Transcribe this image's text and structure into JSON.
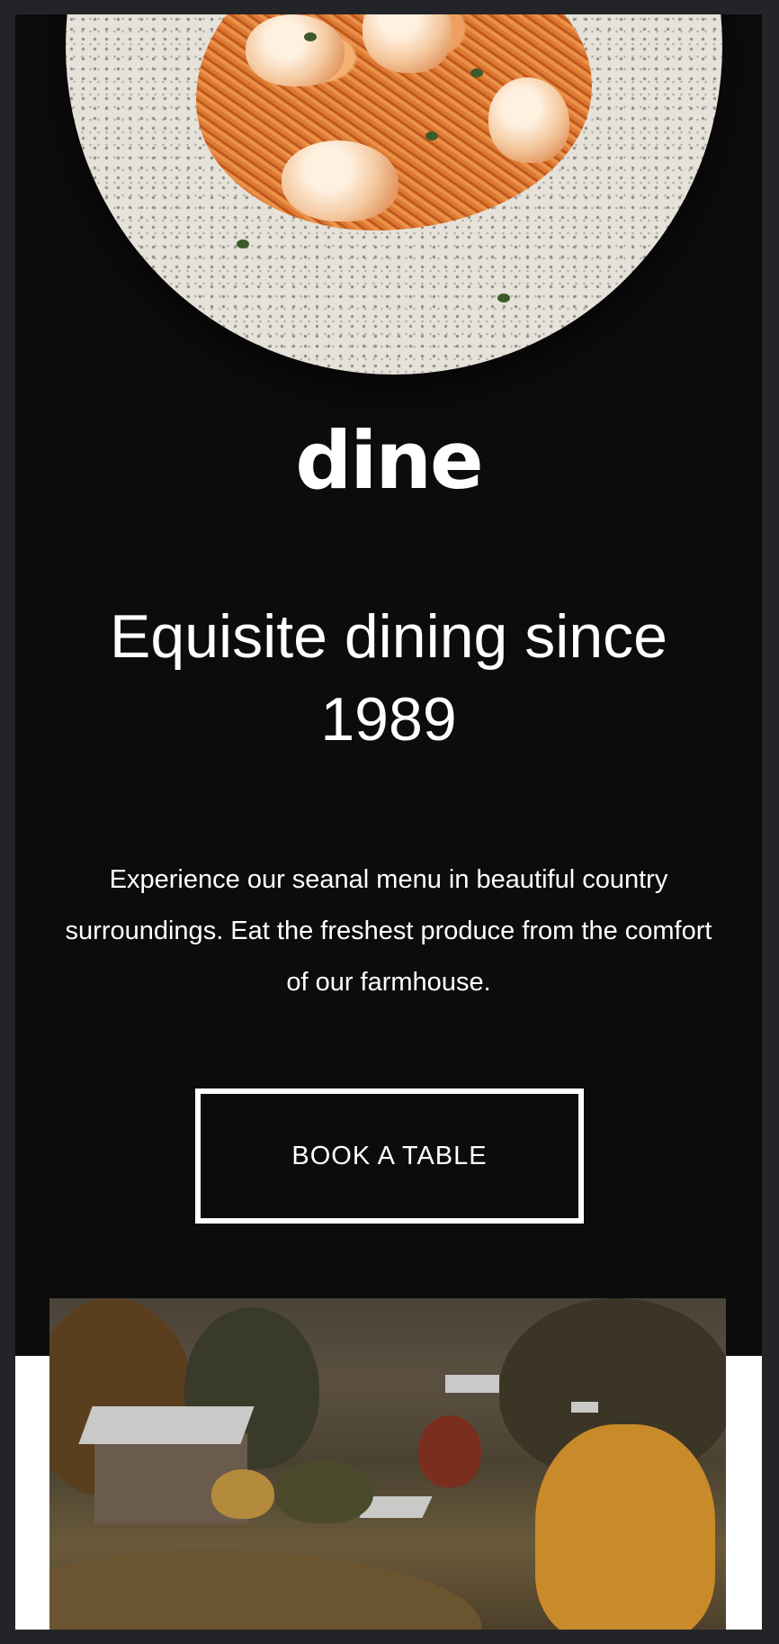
{
  "brand": {
    "logo": "dine"
  },
  "hero": {
    "headline": "Equisite dining since 1989",
    "intro": "Experience our seanal menu in beautiful country surroundings. Eat the freshest produce from the comfort of our farmhouse.",
    "cta_label": "BOOK A TABLE"
  },
  "images": {
    "hero_dish": "shrimp-pasta-plate",
    "village": "autumn-countryside-village"
  },
  "colors": {
    "background": "#0c0c0c",
    "outer": "#232427",
    "text": "#ffffff",
    "accent": "#ffffff"
  }
}
